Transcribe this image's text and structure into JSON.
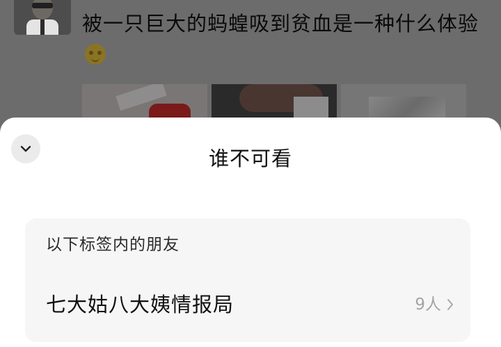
{
  "post": {
    "text": "被一只巨大的蚂蝗吸到贫血是一种什么体验"
  },
  "sheet": {
    "title": "谁不可看",
    "section_label": "以下标签内的朋友",
    "tags": [
      {
        "name": "七大姑八大姨情报局",
        "count": "9人"
      }
    ]
  },
  "icons": {
    "collapse": "chevron-down-icon",
    "emoji": "money-eyes-emoji-icon",
    "row_arrow": "chevron-right-icon"
  }
}
